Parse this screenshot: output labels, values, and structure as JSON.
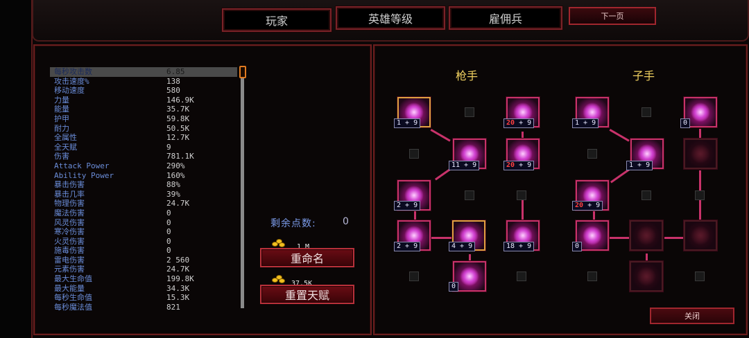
{
  "tabs": {
    "player": "玩家",
    "hero_level": "英雄等级",
    "mercenary": "雇佣兵",
    "next_page": "下一页"
  },
  "stats": [
    {
      "name": "每秒攻击数",
      "value": "6.85",
      "selected": true
    },
    {
      "name": "攻击速度%",
      "value": "138"
    },
    {
      "name": "移动速度",
      "value": "580"
    },
    {
      "name": "力量",
      "value": "146.9K"
    },
    {
      "name": "能量",
      "value": "35.7K"
    },
    {
      "name": "护甲",
      "value": "59.8K"
    },
    {
      "name": "耐力",
      "value": "50.5K"
    },
    {
      "name": "全属性",
      "value": "12.7K"
    },
    {
      "name": "全天赋",
      "value": "9"
    },
    {
      "name": "伤害",
      "value": "781.1K"
    },
    {
      "name": "Attack Power",
      "value": "290%"
    },
    {
      "name": "Ability Power",
      "value": "160%"
    },
    {
      "name": "暴击伤害",
      "value": "88%"
    },
    {
      "name": "暴击几率",
      "value": "39%"
    },
    {
      "name": "物理伤害",
      "value": "24.7K"
    },
    {
      "name": "魔法伤害",
      "value": "0"
    },
    {
      "name": "风灵伤害",
      "value": "0"
    },
    {
      "name": "寒冷伤害",
      "value": "0"
    },
    {
      "name": "火灵伤害",
      "value": "0"
    },
    {
      "name": "施毒伤害",
      "value": "0"
    },
    {
      "name": "雷电伤害",
      "value": "2 560"
    },
    {
      "name": "元素伤害",
      "value": "24.7K"
    },
    {
      "name": "最大生命值",
      "value": "199.8K"
    },
    {
      "name": "最大能量",
      "value": "34.3K"
    },
    {
      "name": "每秒生命值",
      "value": "15.3K"
    },
    {
      "name": "每秒魔法值",
      "value": "821"
    }
  ],
  "remaining": {
    "label": "剩余点数:",
    "value": "0"
  },
  "rename": {
    "cost": "1 M",
    "label": "重命名"
  },
  "reset": {
    "cost": "37.5K",
    "label": "重置天赋"
  },
  "trees": {
    "gunner": "枪手",
    "bullet": "子手"
  },
  "badges": {
    "g1": "1 + 9",
    "g2": "11 + 9",
    "g3": "2 + 9",
    "g4": "2 + 9",
    "g5": "4 + 9",
    "g6": "0",
    "g7_a": "20",
    "g7_b": "+ 9",
    "g8_a": "20",
    "g8_b": "+ 9",
    "g9": "18 + 9",
    "b1": "1 + 9",
    "b2": "1 + 9",
    "b3_a": "20",
    "b3_b": "+ 9",
    "b4": "0",
    "b5": "0"
  },
  "close": "关闭",
  "colors": {
    "accent": "#c8326a",
    "gold": "#f0d060",
    "stat_name": "#6a8cd8"
  }
}
